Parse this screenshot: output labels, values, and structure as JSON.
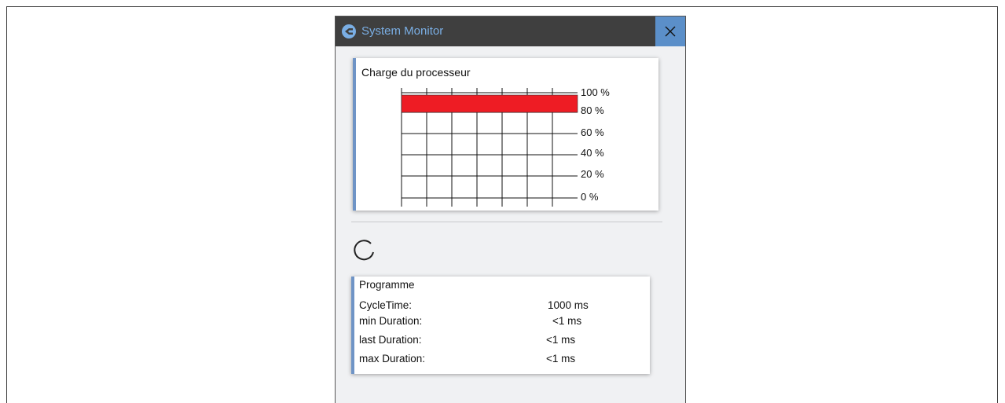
{
  "window": {
    "title": "System Monitor",
    "close_icon": "close-icon",
    "app_icon": "app-logo-icon"
  },
  "cpu_panel": {
    "title": "Charge du processeur",
    "accent_color": "#6f94c6",
    "bar_color": "#ee1c24"
  },
  "chart_data": {
    "type": "bar",
    "orientation": "horizontal",
    "title": "Charge du processeur",
    "y_ticks": [
      "100 %",
      "80 %",
      "60 %",
      "40 %",
      "20 %",
      "0 %"
    ],
    "ylim": [
      0,
      100
    ],
    "grid": true,
    "values": [
      100
    ]
  },
  "program_panel": {
    "title": "Programme",
    "rows": [
      {
        "label": "CycleTime:",
        "value": "1000 ms"
      },
      {
        "label": "min Duration:",
        "value": "<1 ms"
      },
      {
        "label": "last Duration:",
        "value": "<1 ms"
      },
      {
        "label": "max Duration:",
        "value": "<1 ms"
      }
    ]
  },
  "spinner_icon": "loading-spinner-icon"
}
